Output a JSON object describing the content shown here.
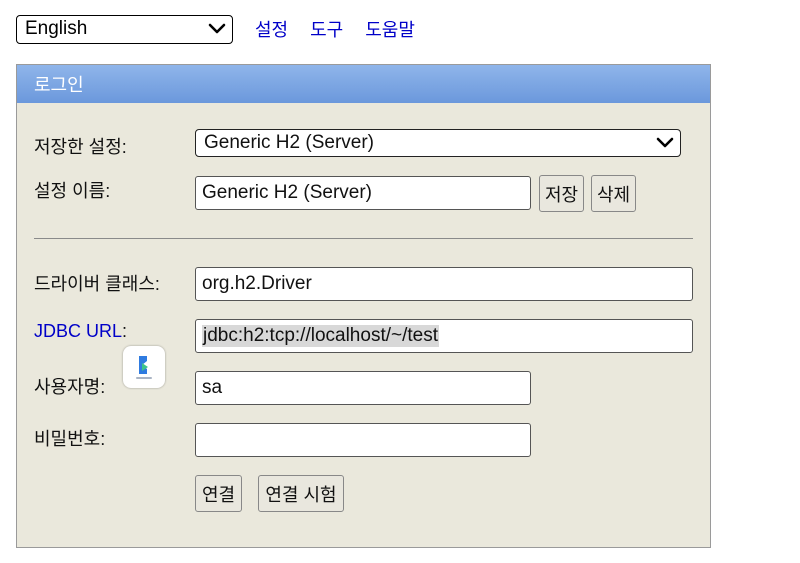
{
  "top": {
    "language": "English",
    "links": [
      "설정",
      "도구",
      "도움말"
    ]
  },
  "panel": {
    "title": "로그인",
    "saved_settings": {
      "label": "저장한 설정:",
      "value": "Generic H2 (Server)"
    },
    "setting_name": {
      "label": "설정 이름:",
      "value": "Generic H2 (Server)"
    },
    "save_button": "저장",
    "delete_button": "삭제",
    "driver_class": {
      "label": "드라이버 클래스:",
      "value": "org.h2.Driver"
    },
    "jdbc_url": {
      "label": "JDBC URL",
      "colon": ":",
      "value": "jdbc:h2:tcp://localhost/~/test"
    },
    "username": {
      "label": "사용자명:",
      "value": "sa"
    },
    "password": {
      "label": "비밀번호:",
      "value": ""
    },
    "connect_button": "연결",
    "test_button": "연결 시험"
  },
  "colors": {
    "link": "#0000c8",
    "header_top": "#8fb5ea",
    "header_bottom": "#6b98dc",
    "panel_bg": "#eae8dc"
  },
  "icons": {
    "select_arrow": "chevron-down-icon",
    "badge": "translate-badge-icon"
  }
}
